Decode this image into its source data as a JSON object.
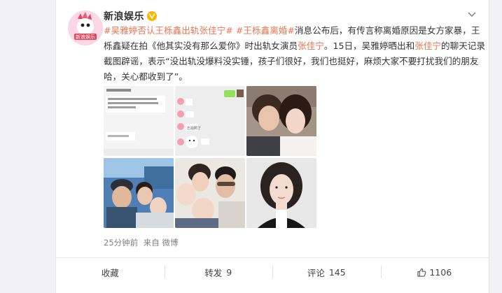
{
  "post": {
    "author": "新浪娱乐",
    "text_segments": [
      {
        "text": "#吴雅婷否认王栎鑫出轨",
        "type": "tag"
      },
      {
        "text": "张佳宁",
        "type": "person"
      },
      {
        "text": "#",
        "type": "tag"
      },
      {
        "text": " ",
        "type": "plain"
      },
      {
        "text": "#王栎鑫离婚#",
        "type": "tag"
      },
      {
        "text": "消息公布后，有传言称离婚原因是女方家暴，王栎鑫疑在拍《他其实没有那么爱你》时出轨女演员",
        "type": "plain"
      },
      {
        "text": "张佳宁",
        "type": "person"
      },
      {
        "text": "。15日，吴雅婷晒出和",
        "type": "plain"
      },
      {
        "text": "张佳宁",
        "type": "person"
      },
      {
        "text": "的聊天记录截图辟谣，表示“没出轨没爆料没实锤，孩子们很好，我们也挺好，麻烦大家不要打扰我们的朋友哈，关心都收到了”。",
        "type": "plain"
      }
    ],
    "time": "25分钟前",
    "source": "来自 微博"
  },
  "actions": {
    "favorite": "收藏",
    "repost": "转发",
    "repost_count": "9",
    "comment": "评论",
    "comment_count": "145",
    "like_count": "1106"
  },
  "images": [
    {
      "name": "chat-screenshot-1"
    },
    {
      "name": "chat-screenshot-2"
    },
    {
      "name": "selfie-couple"
    },
    {
      "name": "family-outdoor-selfie"
    },
    {
      "name": "family-group-photo"
    },
    {
      "name": "portrait-woman"
    }
  ],
  "icon_names": [
    "sina-entertainment-avatar",
    "verified-badge-icon",
    "more-chevron-icon",
    "thumb-up-icon"
  ],
  "colors": {
    "tag": "#eb7350",
    "verified": "#ffb400",
    "meta": "#808080"
  }
}
